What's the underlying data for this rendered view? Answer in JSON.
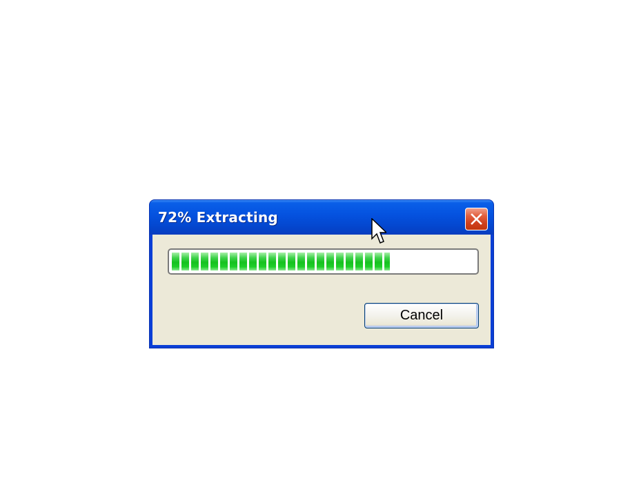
{
  "dialog": {
    "title": "72% Extracting",
    "progress_percent": 72,
    "cancel_label": "Cancel"
  },
  "icons": {
    "close": "close-icon",
    "cursor": "mouse-cursor-icon"
  },
  "colors": {
    "titlebar": "#0553e0",
    "client_bg": "#ece9d8",
    "progress_fill": "#15c11f",
    "close_button": "#cf3f1c"
  }
}
